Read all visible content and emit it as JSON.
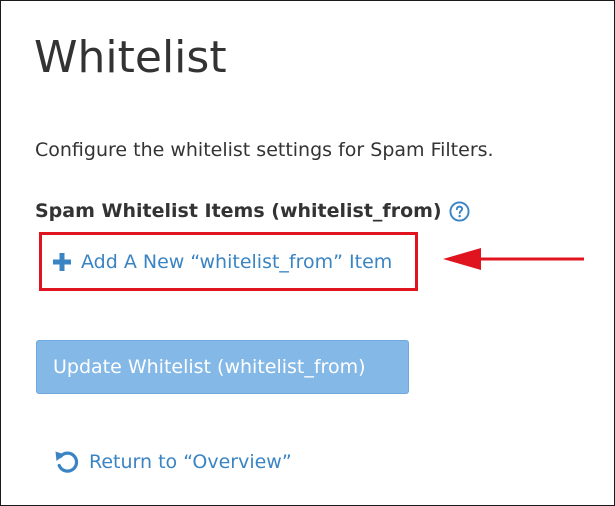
{
  "page": {
    "title": "Whitelist",
    "description": "Configure the whitelist settings for Spam Filters."
  },
  "section": {
    "label": "Spam Whitelist Items (whitelist_from)",
    "help_icon": "question-circle-icon"
  },
  "add_link": {
    "icon": "plus-icon",
    "label": "Add A New “whitelist_from” Item"
  },
  "update_button": {
    "label": "Update Whitelist (whitelist_from)",
    "state": "disabled"
  },
  "return_link": {
    "icon": "undo-icon",
    "label": "Return to “Overview”"
  },
  "annotation": {
    "highlight_color": "#e0141e",
    "arrow_color": "#e0141e"
  },
  "colors": {
    "text": "#333333",
    "link": "#3a84c4",
    "button_disabled_bg": "#84b8e6"
  }
}
